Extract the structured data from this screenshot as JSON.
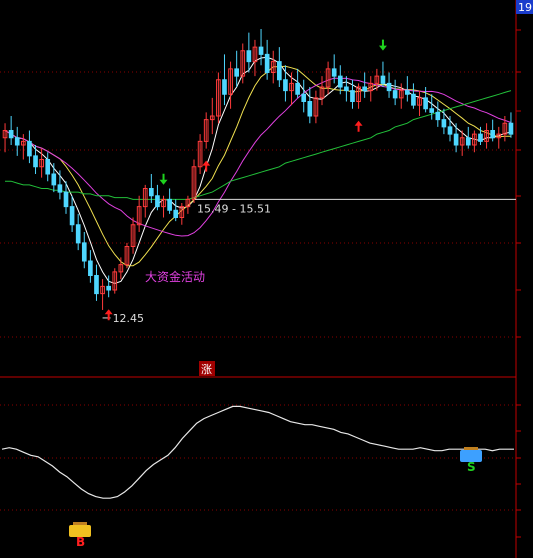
{
  "colors": {
    "background": "#000000",
    "up_candle": "#ff3b3b",
    "down_candle": "#4fd7ff",
    "ma_short": "#ffffff",
    "ma_mid": "#f0e050",
    "ma_long": "#e040e0",
    "ma_longest": "#22c03a",
    "grid": "#8a0000",
    "axis": "#c00000",
    "annotation": "#e040e0",
    "indicator_line": "#e8e8e8",
    "buy_arrow": "#ff1e1e",
    "sell_arrow": "#1ed21e"
  },
  "corner_label": "19",
  "chart_data": {
    "type": "candlestick",
    "title": "",
    "price_labels": {
      "low_marker": "12.45",
      "range_marker": "15.49 - 15.51"
    },
    "annotations": {
      "capital_activity": "大资金活动",
      "divider_badge": "涨"
    },
    "signals": [
      {
        "type": "sell",
        "index": 26
      },
      {
        "type": "buy",
        "index": 17
      },
      {
        "type": "buy",
        "index": 33
      },
      {
        "type": "sell",
        "index": 62
      },
      {
        "type": "buy",
        "index": 58
      }
    ],
    "indicator_signals": [
      {
        "type": "buy",
        "label": "B",
        "index": 14
      },
      {
        "type": "sell",
        "label": "S",
        "index": 83
      }
    ],
    "candles": [
      [
        17.2,
        17.6,
        16.8,
        17.4
      ],
      [
        17.4,
        17.8,
        17.0,
        17.2
      ],
      [
        17.2,
        17.5,
        16.7,
        17.0
      ],
      [
        17.0,
        17.3,
        16.6,
        17.1
      ],
      [
        17.1,
        17.4,
        16.5,
        16.7
      ],
      [
        16.7,
        17.0,
        16.2,
        16.4
      ],
      [
        16.4,
        16.9,
        16.1,
        16.6
      ],
      [
        16.6,
        16.8,
        16.0,
        16.2
      ],
      [
        16.2,
        16.5,
        15.7,
        15.9
      ],
      [
        15.9,
        16.3,
        15.5,
        15.7
      ],
      [
        15.7,
        16.0,
        15.1,
        15.3
      ],
      [
        15.3,
        15.6,
        14.6,
        14.8
      ],
      [
        14.8,
        15.1,
        14.1,
        14.3
      ],
      [
        14.3,
        14.6,
        13.6,
        13.8
      ],
      [
        13.8,
        14.1,
        13.2,
        13.4
      ],
      [
        13.4,
        13.7,
        12.7,
        12.9
      ],
      [
        12.9,
        13.3,
        12.45,
        13.1
      ],
      [
        13.1,
        13.4,
        12.8,
        13.0
      ],
      [
        13.0,
        13.6,
        12.9,
        13.5
      ],
      [
        13.5,
        13.9,
        13.3,
        13.7
      ],
      [
        13.7,
        14.3,
        13.6,
        14.2
      ],
      [
        14.2,
        15.0,
        14.0,
        14.8
      ],
      [
        14.8,
        15.6,
        14.6,
        15.3
      ],
      [
        15.3,
        15.9,
        15.0,
        15.8
      ],
      [
        15.8,
        16.2,
        15.4,
        15.6
      ],
      [
        15.6,
        15.9,
        15.2,
        15.3
      ],
      [
        15.3,
        15.6,
        15.0,
        15.5
      ],
      [
        15.5,
        15.8,
        15.1,
        15.2
      ],
      [
        15.2,
        15.5,
        14.9,
        15.0
      ],
      [
        15.0,
        15.4,
        14.8,
        15.3
      ],
      [
        15.3,
        15.6,
        15.1,
        15.5
      ],
      [
        15.5,
        16.6,
        15.4,
        16.4
      ],
      [
        16.4,
        17.3,
        16.2,
        17.1
      ],
      [
        17.1,
        17.9,
        16.9,
        17.7
      ],
      [
        17.7,
        18.3,
        17.3,
        17.8
      ],
      [
        17.8,
        19.0,
        17.6,
        18.8
      ],
      [
        18.8,
        19.5,
        18.1,
        18.4
      ],
      [
        18.4,
        19.3,
        18.0,
        19.1
      ],
      [
        19.1,
        19.6,
        18.6,
        18.9
      ],
      [
        18.9,
        19.8,
        18.7,
        19.6
      ],
      [
        19.6,
        20.1,
        19.0,
        19.3
      ],
      [
        19.3,
        19.9,
        18.9,
        19.7
      ],
      [
        19.7,
        20.2,
        19.2,
        19.5
      ],
      [
        19.5,
        19.9,
        18.8,
        19.0
      ],
      [
        19.0,
        19.6,
        18.7,
        19.3
      ],
      [
        19.3,
        19.7,
        18.6,
        18.8
      ],
      [
        18.8,
        19.2,
        18.2,
        18.5
      ],
      [
        18.5,
        19.0,
        18.1,
        18.7
      ],
      [
        18.7,
        19.1,
        18.3,
        18.4
      ],
      [
        18.4,
        18.8,
        17.9,
        18.2
      ],
      [
        18.2,
        18.6,
        17.6,
        17.8
      ],
      [
        17.8,
        18.5,
        17.6,
        18.3
      ],
      [
        18.3,
        18.9,
        18.1,
        18.6
      ],
      [
        18.6,
        19.3,
        18.4,
        19.1
      ],
      [
        19.1,
        19.5,
        18.7,
        18.9
      ],
      [
        18.9,
        19.2,
        18.4,
        18.6
      ],
      [
        18.6,
        18.9,
        18.2,
        18.5
      ],
      [
        18.5,
        18.8,
        18.0,
        18.2
      ],
      [
        18.2,
        18.7,
        18.0,
        18.6
      ],
      [
        18.6,
        19.0,
        18.3,
        18.5
      ],
      [
        18.5,
        18.9,
        18.2,
        18.7
      ],
      [
        18.7,
        19.1,
        18.5,
        18.9
      ],
      [
        18.9,
        19.3,
        18.6,
        18.7
      ],
      [
        18.7,
        19.0,
        18.3,
        18.5
      ],
      [
        18.5,
        18.8,
        18.1,
        18.3
      ],
      [
        18.3,
        18.7,
        18.0,
        18.5
      ],
      [
        18.5,
        18.9,
        18.2,
        18.4
      ],
      [
        18.4,
        18.7,
        18.0,
        18.1
      ],
      [
        18.1,
        18.5,
        17.8,
        18.3
      ],
      [
        18.3,
        18.6,
        17.9,
        18.0
      ],
      [
        18.0,
        18.4,
        17.7,
        17.9
      ],
      [
        17.9,
        18.2,
        17.5,
        17.7
      ],
      [
        17.7,
        18.0,
        17.3,
        17.5
      ],
      [
        17.5,
        17.8,
        17.1,
        17.3
      ],
      [
        17.3,
        17.6,
        16.8,
        17.0
      ],
      [
        17.0,
        17.4,
        16.7,
        17.2
      ],
      [
        17.2,
        17.5,
        16.9,
        17.0
      ],
      [
        17.0,
        17.4,
        16.8,
        17.3
      ],
      [
        17.3,
        17.5,
        17.0,
        17.1
      ],
      [
        17.1,
        17.6,
        16.9,
        17.4
      ],
      [
        17.4,
        17.7,
        17.1,
        17.2
      ],
      [
        17.2,
        17.5,
        16.9,
        17.3
      ],
      [
        17.3,
        17.8,
        17.1,
        17.6
      ],
      [
        17.6,
        17.9,
        17.2,
        17.3
      ]
    ],
    "moving_averages": [
      {
        "name": "MA5",
        "color_key": "ma_short",
        "period": 5
      },
      {
        "name": "MA10",
        "color_key": "ma_mid",
        "period": 10
      },
      {
        "name": "MA20",
        "color_key": "ma_long",
        "period": 20
      },
      {
        "name": "MA60",
        "color_key": "ma_longest",
        "period": 60
      }
    ],
    "longest_ma_seed": [
      16.0,
      16.0,
      15.95,
      15.9,
      15.9,
      15.85,
      15.8,
      15.8,
      15.75,
      15.75,
      15.7,
      15.7,
      15.7,
      15.65,
      15.65,
      15.6,
      15.6,
      15.6,
      15.55,
      15.55,
      15.55,
      15.5,
      15.5,
      15.5,
      15.5,
      15.5,
      15.5,
      15.5,
      15.5,
      15.5,
      15.5,
      15.55,
      15.6,
      15.65,
      15.7,
      15.8,
      15.9,
      16.0,
      16.05,
      16.1,
      16.15,
      16.2,
      16.25,
      16.3,
      16.35,
      16.4,
      16.5,
      16.55,
      16.6,
      16.65,
      16.7,
      16.75,
      16.8,
      16.85,
      16.9,
      16.95,
      17.0,
      17.05,
      17.1,
      17.15,
      17.2,
      17.3,
      17.35,
      17.4,
      17.5,
      17.55,
      17.6,
      17.7,
      17.75,
      17.8,
      17.85,
      17.9,
      17.95,
      18.0,
      18.05,
      18.1,
      18.15,
      18.2,
      18.25,
      18.3,
      18.35,
      18.4,
      18.45,
      18.5
    ],
    "indicator_values": [
      0.6,
      0.61,
      0.6,
      0.58,
      0.56,
      0.55,
      0.52,
      0.49,
      0.45,
      0.42,
      0.38,
      0.34,
      0.31,
      0.29,
      0.28,
      0.28,
      0.29,
      0.32,
      0.36,
      0.41,
      0.46,
      0.5,
      0.53,
      0.56,
      0.61,
      0.67,
      0.72,
      0.77,
      0.8,
      0.82,
      0.84,
      0.86,
      0.88,
      0.88,
      0.87,
      0.86,
      0.85,
      0.84,
      0.82,
      0.8,
      0.78,
      0.77,
      0.76,
      0.76,
      0.75,
      0.74,
      0.73,
      0.71,
      0.7,
      0.68,
      0.66,
      0.64,
      0.63,
      0.62,
      0.61,
      0.6,
      0.6,
      0.6,
      0.61,
      0.6,
      0.59,
      0.59,
      0.6,
      0.6,
      0.6,
      0.6,
      0.6,
      0.6,
      0.59,
      0.6,
      0.6,
      0.6
    ],
    "price_ylim": [
      10.6,
      21.0
    ]
  }
}
